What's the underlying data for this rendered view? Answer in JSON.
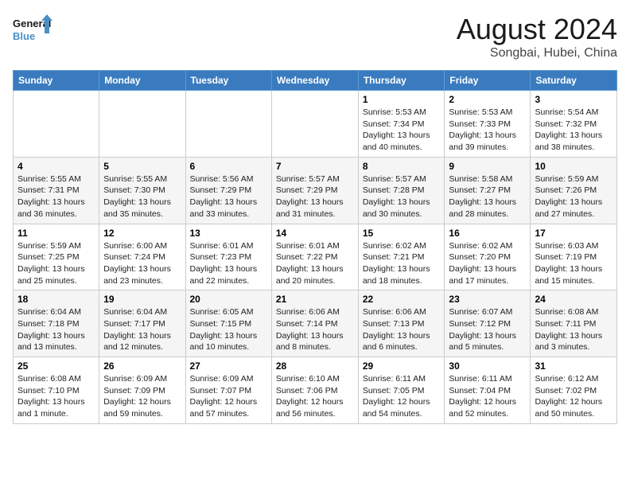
{
  "header": {
    "logo_line1": "General",
    "logo_line2": "Blue",
    "main_title": "August 2024",
    "subtitle": "Songbai, Hubei, China"
  },
  "calendar": {
    "days_of_week": [
      "Sunday",
      "Monday",
      "Tuesday",
      "Wednesday",
      "Thursday",
      "Friday",
      "Saturday"
    ],
    "weeks": [
      [
        {
          "day": "",
          "info": ""
        },
        {
          "day": "",
          "info": ""
        },
        {
          "day": "",
          "info": ""
        },
        {
          "day": "",
          "info": ""
        },
        {
          "day": "1",
          "info": "Sunrise: 5:53 AM\nSunset: 7:34 PM\nDaylight: 13 hours\nand 40 minutes."
        },
        {
          "day": "2",
          "info": "Sunrise: 5:53 AM\nSunset: 7:33 PM\nDaylight: 13 hours\nand 39 minutes."
        },
        {
          "day": "3",
          "info": "Sunrise: 5:54 AM\nSunset: 7:32 PM\nDaylight: 13 hours\nand 38 minutes."
        }
      ],
      [
        {
          "day": "4",
          "info": "Sunrise: 5:55 AM\nSunset: 7:31 PM\nDaylight: 13 hours\nand 36 minutes."
        },
        {
          "day": "5",
          "info": "Sunrise: 5:55 AM\nSunset: 7:30 PM\nDaylight: 13 hours\nand 35 minutes."
        },
        {
          "day": "6",
          "info": "Sunrise: 5:56 AM\nSunset: 7:29 PM\nDaylight: 13 hours\nand 33 minutes."
        },
        {
          "day": "7",
          "info": "Sunrise: 5:57 AM\nSunset: 7:29 PM\nDaylight: 13 hours\nand 31 minutes."
        },
        {
          "day": "8",
          "info": "Sunrise: 5:57 AM\nSunset: 7:28 PM\nDaylight: 13 hours\nand 30 minutes."
        },
        {
          "day": "9",
          "info": "Sunrise: 5:58 AM\nSunset: 7:27 PM\nDaylight: 13 hours\nand 28 minutes."
        },
        {
          "day": "10",
          "info": "Sunrise: 5:59 AM\nSunset: 7:26 PM\nDaylight: 13 hours\nand 27 minutes."
        }
      ],
      [
        {
          "day": "11",
          "info": "Sunrise: 5:59 AM\nSunset: 7:25 PM\nDaylight: 13 hours\nand 25 minutes."
        },
        {
          "day": "12",
          "info": "Sunrise: 6:00 AM\nSunset: 7:24 PM\nDaylight: 13 hours\nand 23 minutes."
        },
        {
          "day": "13",
          "info": "Sunrise: 6:01 AM\nSunset: 7:23 PM\nDaylight: 13 hours\nand 22 minutes."
        },
        {
          "day": "14",
          "info": "Sunrise: 6:01 AM\nSunset: 7:22 PM\nDaylight: 13 hours\nand 20 minutes."
        },
        {
          "day": "15",
          "info": "Sunrise: 6:02 AM\nSunset: 7:21 PM\nDaylight: 13 hours\nand 18 minutes."
        },
        {
          "day": "16",
          "info": "Sunrise: 6:02 AM\nSunset: 7:20 PM\nDaylight: 13 hours\nand 17 minutes."
        },
        {
          "day": "17",
          "info": "Sunrise: 6:03 AM\nSunset: 7:19 PM\nDaylight: 13 hours\nand 15 minutes."
        }
      ],
      [
        {
          "day": "18",
          "info": "Sunrise: 6:04 AM\nSunset: 7:18 PM\nDaylight: 13 hours\nand 13 minutes."
        },
        {
          "day": "19",
          "info": "Sunrise: 6:04 AM\nSunset: 7:17 PM\nDaylight: 13 hours\nand 12 minutes."
        },
        {
          "day": "20",
          "info": "Sunrise: 6:05 AM\nSunset: 7:15 PM\nDaylight: 13 hours\nand 10 minutes."
        },
        {
          "day": "21",
          "info": "Sunrise: 6:06 AM\nSunset: 7:14 PM\nDaylight: 13 hours\nand 8 minutes."
        },
        {
          "day": "22",
          "info": "Sunrise: 6:06 AM\nSunset: 7:13 PM\nDaylight: 13 hours\nand 6 minutes."
        },
        {
          "day": "23",
          "info": "Sunrise: 6:07 AM\nSunset: 7:12 PM\nDaylight: 13 hours\nand 5 minutes."
        },
        {
          "day": "24",
          "info": "Sunrise: 6:08 AM\nSunset: 7:11 PM\nDaylight: 13 hours\nand 3 minutes."
        }
      ],
      [
        {
          "day": "25",
          "info": "Sunrise: 6:08 AM\nSunset: 7:10 PM\nDaylight: 13 hours\nand 1 minute."
        },
        {
          "day": "26",
          "info": "Sunrise: 6:09 AM\nSunset: 7:09 PM\nDaylight: 12 hours\nand 59 minutes."
        },
        {
          "day": "27",
          "info": "Sunrise: 6:09 AM\nSunset: 7:07 PM\nDaylight: 12 hours\nand 57 minutes."
        },
        {
          "day": "28",
          "info": "Sunrise: 6:10 AM\nSunset: 7:06 PM\nDaylight: 12 hours\nand 56 minutes."
        },
        {
          "day": "29",
          "info": "Sunrise: 6:11 AM\nSunset: 7:05 PM\nDaylight: 12 hours\nand 54 minutes."
        },
        {
          "day": "30",
          "info": "Sunrise: 6:11 AM\nSunset: 7:04 PM\nDaylight: 12 hours\nand 52 minutes."
        },
        {
          "day": "31",
          "info": "Sunrise: 6:12 AM\nSunset: 7:02 PM\nDaylight: 12 hours\nand 50 minutes."
        }
      ]
    ]
  }
}
